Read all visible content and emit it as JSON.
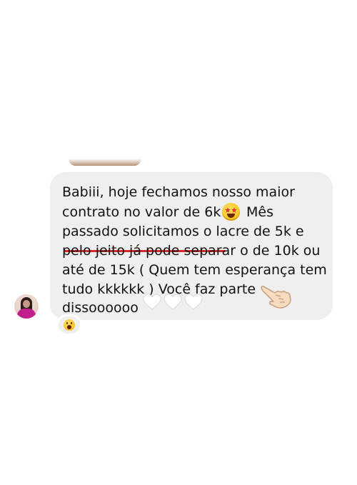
{
  "message": {
    "lines": [
      "Babiii, hoje fechamos nosso maior",
      "contrato no valor de 6k",
      "Mês",
      "passado solicitamos o lacre de 5k e",
      "pelo jeito já pode separar o de 10k ou",
      "até de 15k ( Quem tem esperança tem",
      "tudo kkkkkk ) Você faz parte",
      "dissoooooo"
    ],
    "emojis": [
      "star-struck-icon",
      "white-heart-icon",
      "white-heart-icon",
      "white-heart-icon",
      "backhand-index-pointing-left-icon"
    ]
  },
  "reaction": {
    "emoji": "face-with-open-mouth-icon"
  },
  "colors": {
    "bubble": "#efefef",
    "underline": "#d62828",
    "accent": "#c21f8e"
  }
}
